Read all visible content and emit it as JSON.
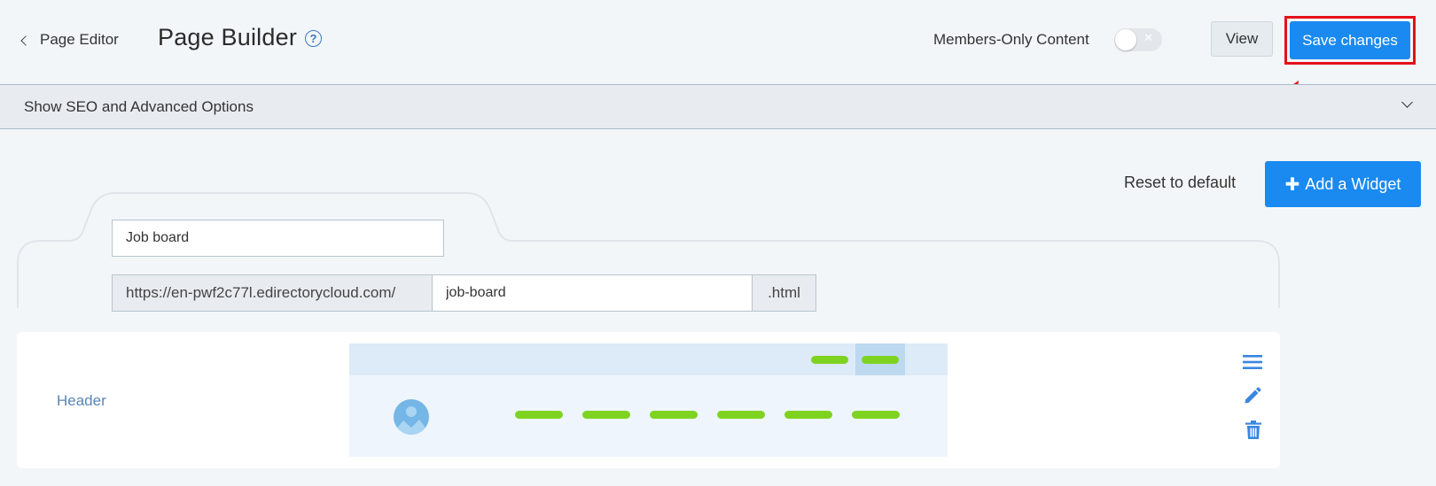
{
  "header": {
    "back_label": "Page Editor",
    "title": "Page Builder",
    "help_glyph": "?",
    "members_label": "Members-Only Content",
    "members_toggle_state": "off",
    "view_label": "View",
    "save_label": "Save changes"
  },
  "seo": {
    "label": "Show SEO and Advanced Options"
  },
  "toolbar": {
    "reset_label": "Reset to default",
    "add_widget_label": "Add a Widget"
  },
  "page_form": {
    "title_value": "Job board",
    "url_prefix": "https://en-pwf2c77l.edirectorycloud.com/",
    "slug_value": "job-board",
    "url_suffix": ".html"
  },
  "widgets": [
    {
      "label": "Header"
    }
  ],
  "colors": {
    "primary": "#1a8af0",
    "highlight_annotation": "#e5111a",
    "preview_bars": "#7ed321",
    "label_blue": "#5a86b5"
  },
  "icons": [
    "chevron-left-icon",
    "help-icon",
    "close-icon",
    "chevron-down-icon",
    "plus-icon",
    "image-avatar-icon",
    "hamburger-menu-icon",
    "pencil-icon",
    "trash-icon"
  ]
}
